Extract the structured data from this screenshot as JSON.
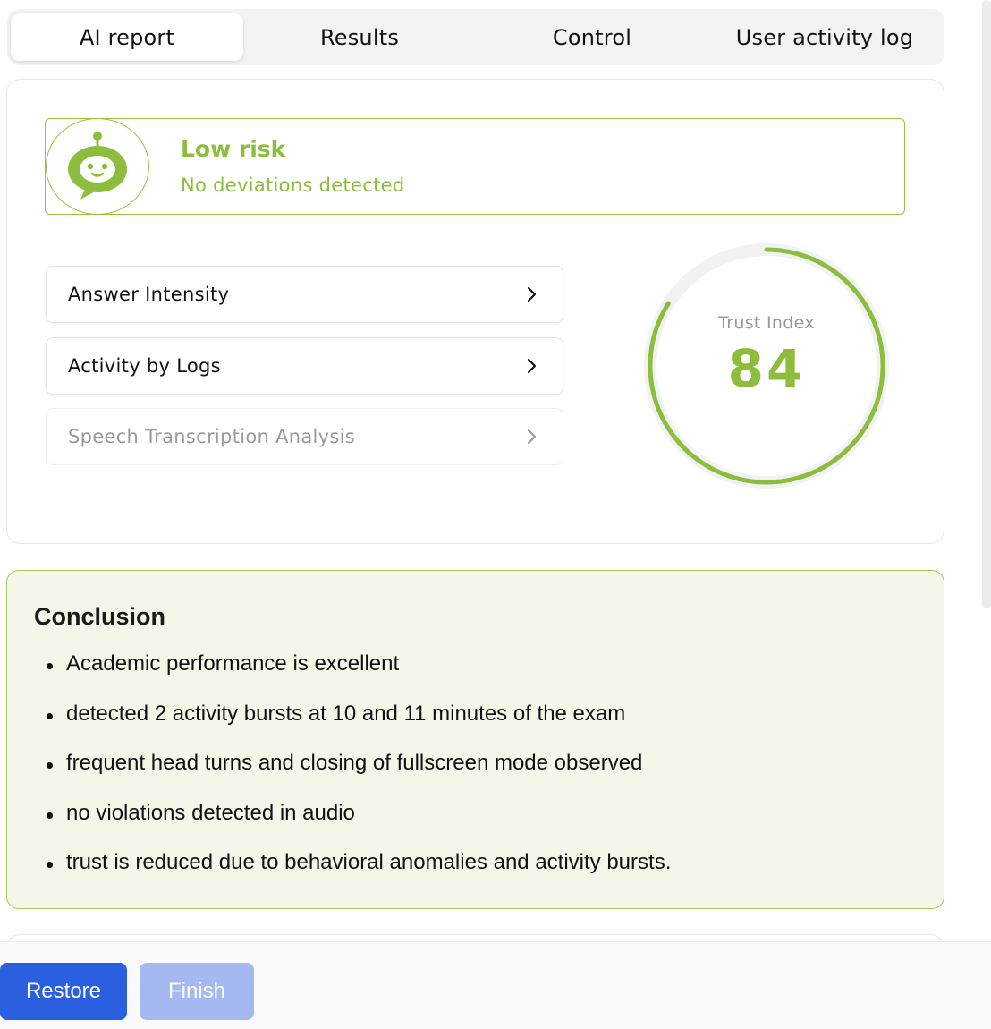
{
  "tabs": [
    {
      "label": "AI report",
      "active": true
    },
    {
      "label": "Results",
      "active": false
    },
    {
      "label": "Control",
      "active": false
    },
    {
      "label": "User activity log",
      "active": false
    }
  ],
  "risk": {
    "icon": "robot-chat-icon",
    "title": "Low risk",
    "subtitle": "No deviations detected",
    "color": "#8dbd3c"
  },
  "metrics": [
    {
      "label": "Answer Intensity",
      "enabled": true
    },
    {
      "label": "Activity by Logs",
      "enabled": true
    },
    {
      "label": "Speech Transcription Analysis",
      "enabled": false
    }
  ],
  "trust": {
    "label": "Trust Index",
    "value": "84",
    "fraction": 0.84,
    "color": "#8dbd3c"
  },
  "conclusion": {
    "title": "Conclusion",
    "items": [
      "Academic performance is excellent",
      "detected 2 activity bursts at 10 and 11 minutes of the exam",
      "frequent head turns and closing of fullscreen mode observed",
      "no violations detected in audio",
      "trust is reduced due to behavioral anomalies and activity bursts."
    ]
  },
  "footer": {
    "restore_label": "Restore",
    "finish_label": "Finish"
  }
}
